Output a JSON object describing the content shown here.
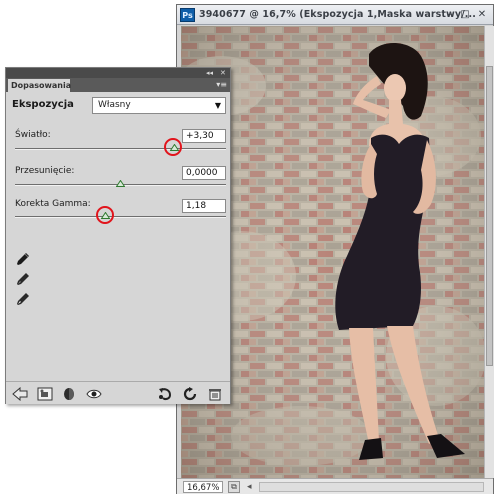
{
  "document": {
    "app_badge": "Ps",
    "title": "3940677 @ 16,7% (Ekspozycja 1,Maska warstwy/...",
    "zoom": "16,67%",
    "controls": {
      "minimize": "–",
      "maximize": "□",
      "close": "✕"
    }
  },
  "panel": {
    "tab_label": "Dopasowania",
    "collapse_glyph": "◂◂",
    "close_glyph": "✕",
    "menu_glyph": "▾≡",
    "preset_label": "Ekspozycja",
    "preset_value": "Własny",
    "params": [
      {
        "label": "Światło:",
        "value": "+3,30",
        "level": 0.755,
        "highlighted": true
      },
      {
        "label": "Przesunięcie:",
        "value": "0,0000",
        "level": 0.5,
        "highlighted": false
      },
      {
        "label": "Korekta Gamma:",
        "value": "1,18",
        "level": 0.43,
        "highlighted": true
      }
    ],
    "eyedroppers": [
      "eyedropper-black-icon",
      "eyedropper-gray-icon",
      "eyedropper-white-icon"
    ],
    "bottom_icons": [
      "back-arrow-icon",
      "clip-layer-icon",
      "visibility-mask-icon",
      "eye-icon",
      "previous-state-icon",
      "reset-icon",
      "trash-icon"
    ]
  },
  "colors": {
    "highlight_ring": "#e1141c",
    "thumb_fill": "#d8ead8",
    "thumb_stroke": "#2f7a2f",
    "dress": "#221c26"
  }
}
